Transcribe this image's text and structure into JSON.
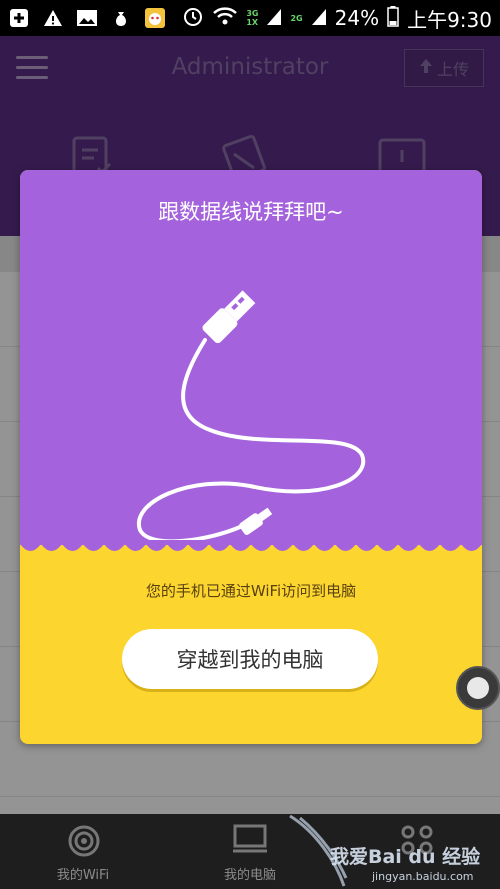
{
  "status_bar": {
    "battery": "24%",
    "time": "上午9:30",
    "net_top": "3G",
    "net_bottom": "1X",
    "net2": "2G"
  },
  "header": {
    "title": "Administrator",
    "upload_label": "上传"
  },
  "dialog": {
    "title": "跟数据线说拜拜吧~",
    "message": "您的手机已通过WiFi访问到电脑",
    "button_label": "穿越到我的电脑",
    "top_color": "#a463dc",
    "bottom_color": "#fcd52f"
  },
  "bottom_nav": {
    "items": [
      {
        "label": "我的WiFi"
      },
      {
        "label": "我的电脑"
      }
    ]
  },
  "watermark": {
    "text": "我爱Bai du 经验",
    "domain": "jingyan.baidu.com"
  }
}
